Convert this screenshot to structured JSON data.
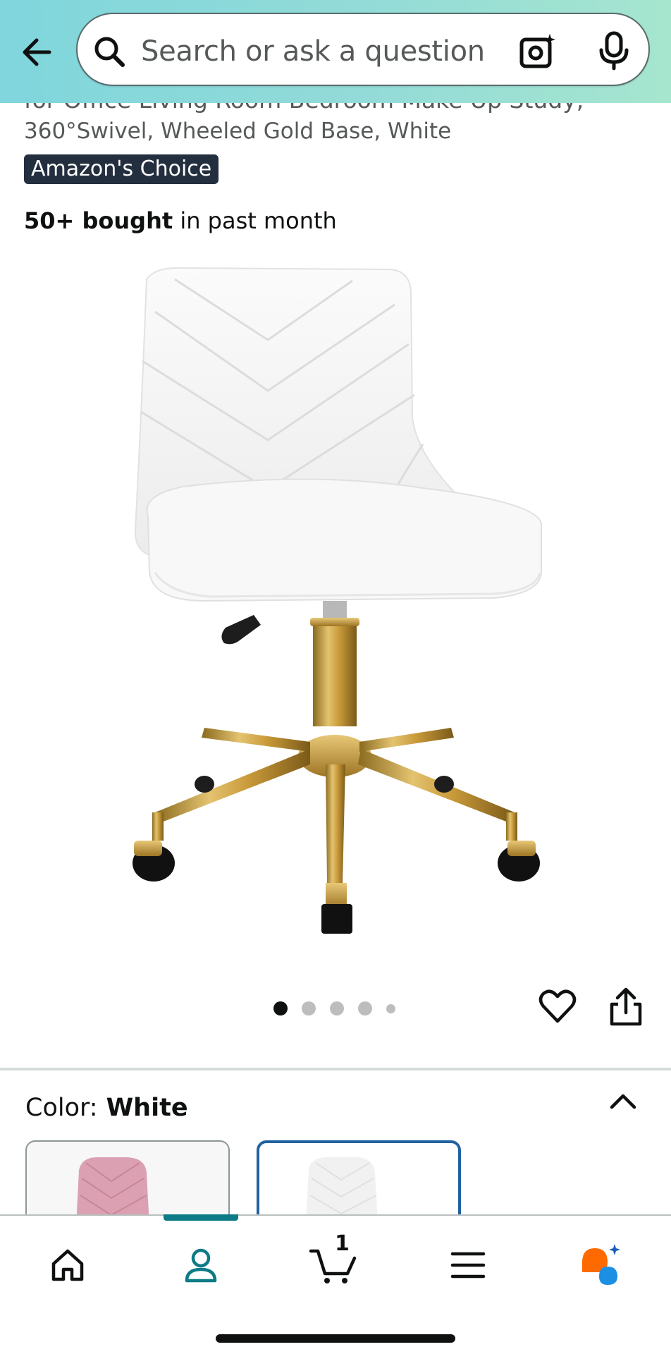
{
  "search": {
    "placeholder": "Search or ask a question"
  },
  "product": {
    "title_partial_line": "for Office Living Room Bedroom Make Up Study,",
    "title_line": "360°Swivel, Wheeled Gold Base, White",
    "badge": "Amazon's Choice",
    "bought_bold": "50+ bought",
    "bought_rest": " in past month"
  },
  "carousel": {
    "total_images": 5,
    "active_index": 0
  },
  "color": {
    "label": "Color:",
    "selected": "White",
    "options": [
      "Pink",
      "White"
    ]
  },
  "nav": {
    "cart_count": "1",
    "active_tab": "account"
  },
  "colors": {
    "header_gradient_start": "#7fd6dc",
    "header_gradient_end": "#a6e6cf",
    "badge_bg": "#232f3e",
    "accent_teal": "#0d7b85",
    "selected_swatch_border": "#2162a1",
    "rufus_orange": "#ff6a00",
    "rufus_blue": "#1a8fe3"
  },
  "icons": [
    "back-arrow-icon",
    "search-icon",
    "camera-icon",
    "mic-icon",
    "heart-icon",
    "share-icon",
    "chevron-up-icon",
    "home-icon",
    "account-icon",
    "cart-icon",
    "menu-icon",
    "rufus-icon"
  ]
}
